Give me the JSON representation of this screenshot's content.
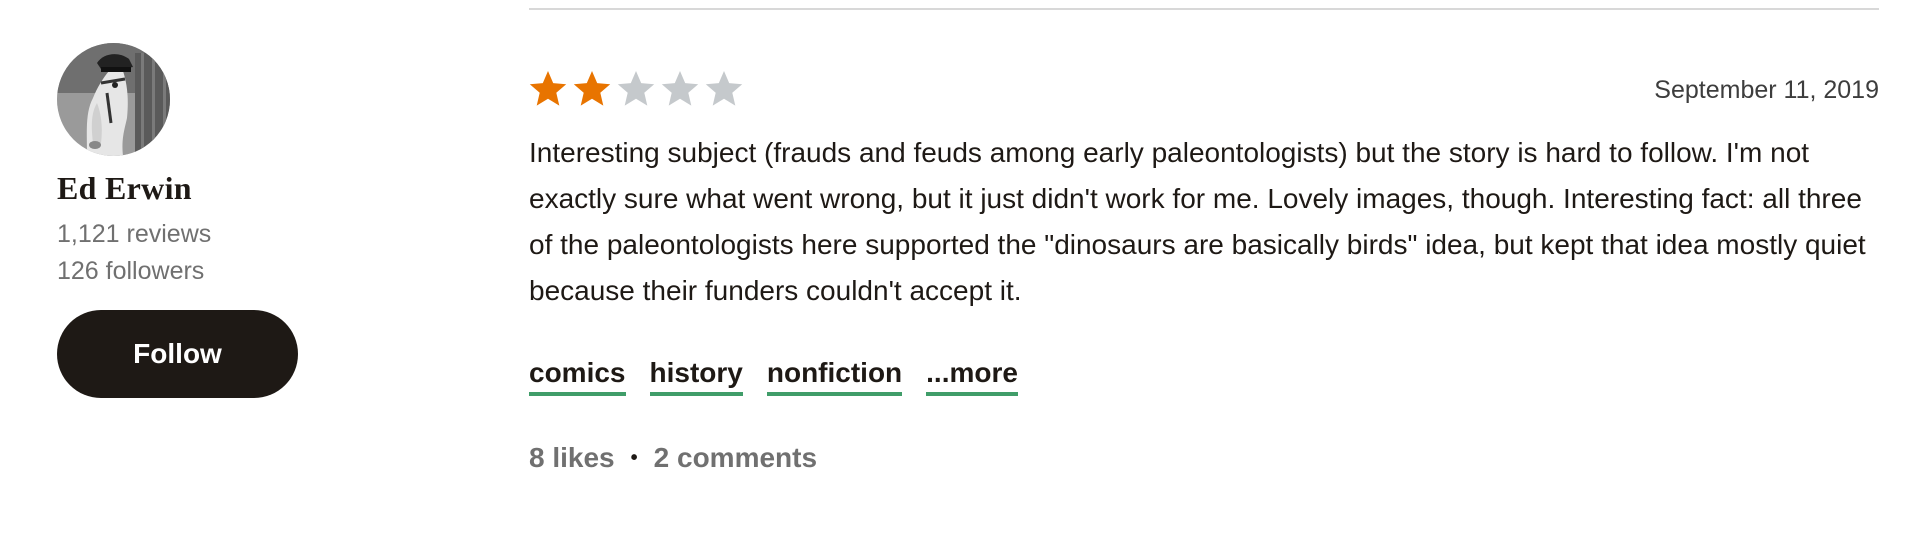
{
  "reviewer": {
    "name": "Ed Erwin",
    "reviews": "1,121 reviews",
    "followers": "126 followers",
    "follow_label": "Follow"
  },
  "review": {
    "rating": 2,
    "max_rating": 5,
    "date": "September 11, 2019",
    "text": "Interesting subject (frauds and feuds among early paleontologists) but the story is hard to follow. I'm not exactly sure what went wrong, but it just didn't work for me. Lovely images, though. Interesting fact: all three of the paleontologists here supported the \"dinosaurs are basically birds\" idea, but kept that idea mostly quiet because their funders couldn't accept it.",
    "shelves": [
      "comics",
      "history",
      "nonfiction",
      "...more"
    ],
    "likes": "8 likes",
    "separator": "•",
    "comments": "2 comments"
  },
  "colors": {
    "star_filled": "#e87400",
    "star_empty": "#c5c9cc",
    "shelf_underline": "#409d69",
    "follow_bg": "#1e1915"
  },
  "icons": {
    "star": "star-icon",
    "avatar": "horse-with-cap-photo"
  }
}
